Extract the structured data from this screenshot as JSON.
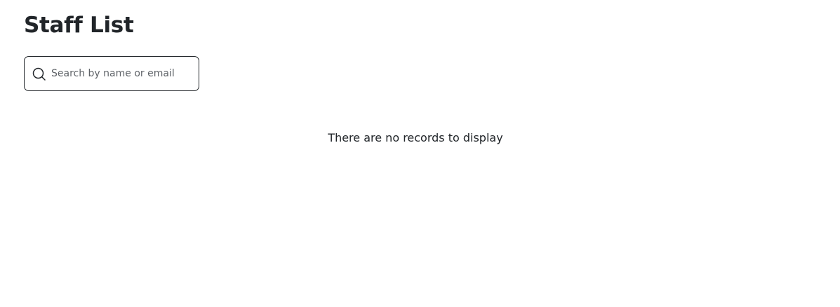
{
  "page": {
    "title": "Staff List"
  },
  "search": {
    "placeholder": "Search by name or email",
    "value": "",
    "icon": "search-icon"
  },
  "table": {
    "empty_message": "There are no records to display"
  },
  "colors": {
    "text": "#212529",
    "border": "#212529",
    "background": "#ffffff"
  }
}
